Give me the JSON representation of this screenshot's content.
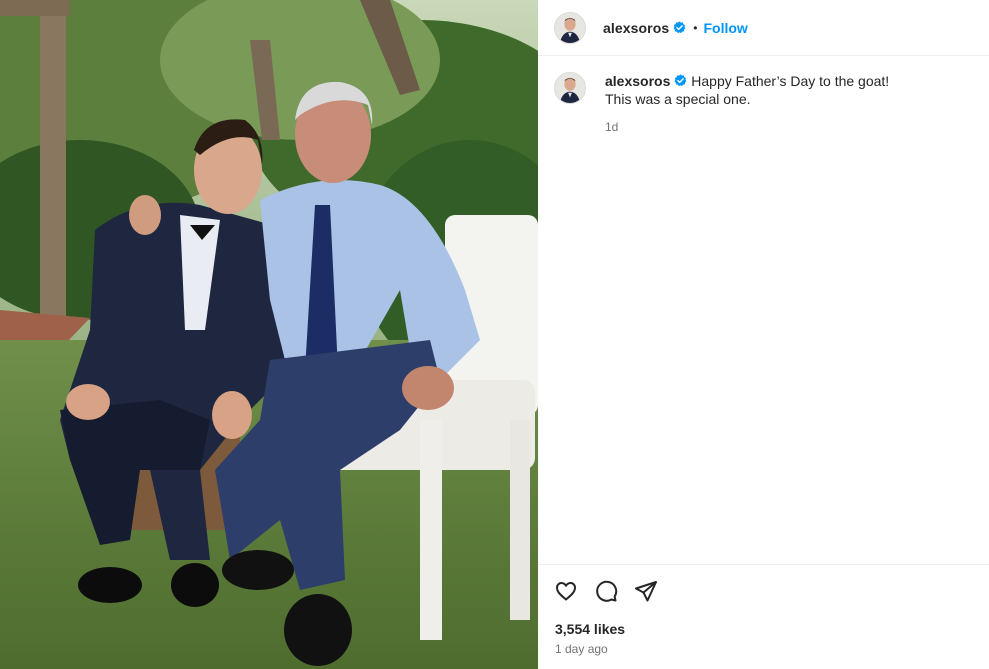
{
  "post": {
    "image_alt": "Two men seated outdoors on a white garden chair",
    "username": "alexsoros",
    "verified": true,
    "separator": "•",
    "follow_label": "Follow",
    "caption_line1": "Happy Father’s Day to the goat!",
    "caption_line2": "This was a special one.",
    "caption_age": "1d",
    "likes": "3,554 likes",
    "posted_ago": "1 day ago"
  },
  "icons": {
    "like": "heart-icon",
    "comment": "comment-icon",
    "share": "paper-plane-icon",
    "verified": "verified-badge-icon"
  },
  "colors": {
    "follow": "#0095f6",
    "verified": "#0095f6",
    "secondary_text": "#737373"
  }
}
